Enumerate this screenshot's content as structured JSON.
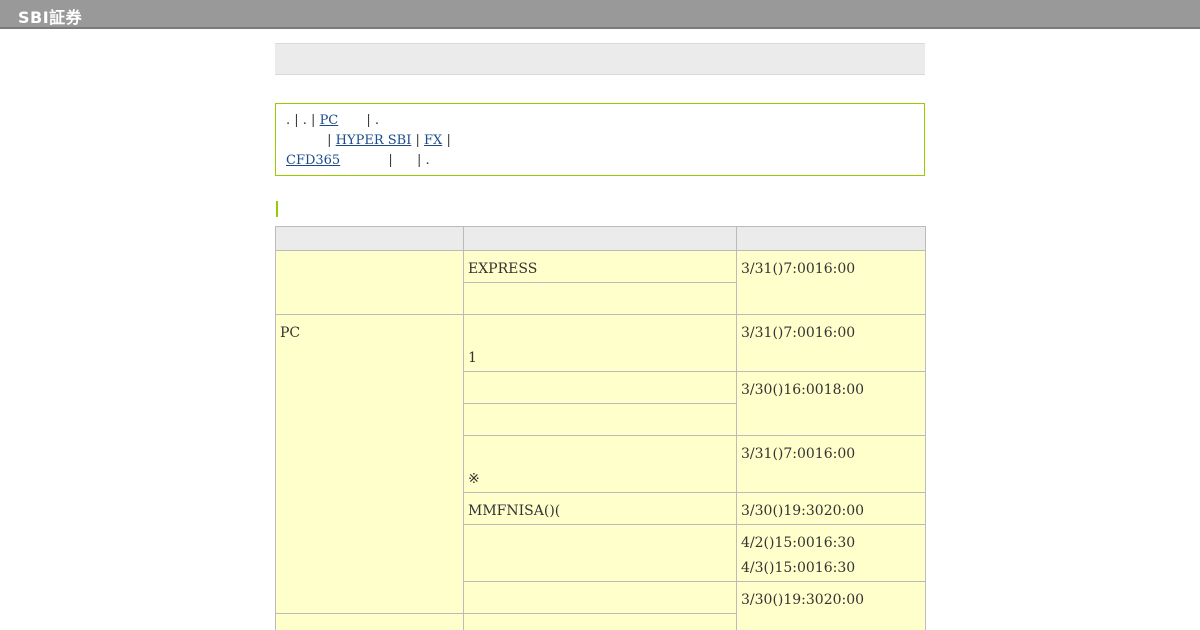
{
  "header": {
    "logo_text": "SBI証券"
  },
  "info_links": {
    "line1_prefix": ". | . |",
    "pc_link": "PC",
    "line1_suffix": "| .",
    "line2_sep1": "|",
    "hyper_sbi_link": "HYPER SBI",
    "line2_sep2": "|",
    "fx_link": "FX",
    "line2_sep3": "|",
    "cfd_link": "CFD365",
    "line3_sep1": "|",
    "line3_suffix": "| ."
  },
  "table": {
    "rows": {
      "r1_service": "EXPRESS",
      "r1_time": "3/31()7:0016:00",
      "r3_category": "PC",
      "r3_service_line2": "1",
      "r3_time": "3/31()7:0016:00",
      "r4_time": "3/30()16:0018:00",
      "r6_service_line2": "※",
      "r6_time": "3/31()7:0016:00",
      "r7_service": "MMFNISA()(",
      "r7_time": "3/30()19:3020:00",
      "r8_time_line1": "4/2()15:0016:30",
      "r8_time_line2": "4/3()15:0016:30",
      "r9_time": "3/30()19:3020:00"
    }
  },
  "colors": {
    "topbar": "#999999",
    "box_border": "#99cc00",
    "cell_bg": "#ffffcc",
    "header_bg": "#ebebeb",
    "link": "#1a4a8a"
  }
}
